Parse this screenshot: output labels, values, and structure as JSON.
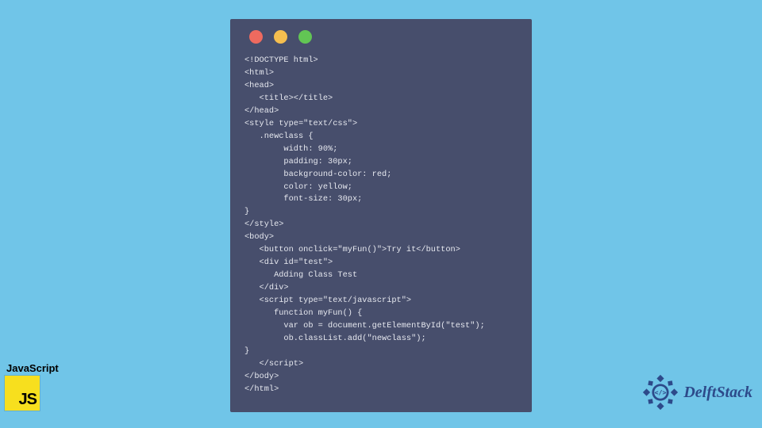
{
  "code_lines": [
    "<!DOCTYPE html>",
    "<html>",
    "<head>",
    "   <title></title>",
    "</head>",
    "<style type=\"text/css\">",
    "   .newclass {",
    "        width: 90%;",
    "        padding: 30px;",
    "        background-color: red;",
    "        color: yellow;",
    "        font-size: 30px;",
    "}",
    "</style>",
    "<body>",
    "   <button onclick=\"myFun()\">Try it</button>",
    "   <div id=\"test\">",
    "      Adding Class Test",
    "   </div>",
    "   <script type=\"text/javascript\">",
    "      function myFun() {",
    "        var ob = document.getElementById(\"test\");",
    "        ob.classList.add(\"newclass\");",
    "}",
    "   </script>",
    "</body>",
    "</html>"
  ],
  "badge": {
    "language_label": "JavaScript",
    "logo_text": "JS"
  },
  "brand": {
    "name": "DelftStack"
  }
}
